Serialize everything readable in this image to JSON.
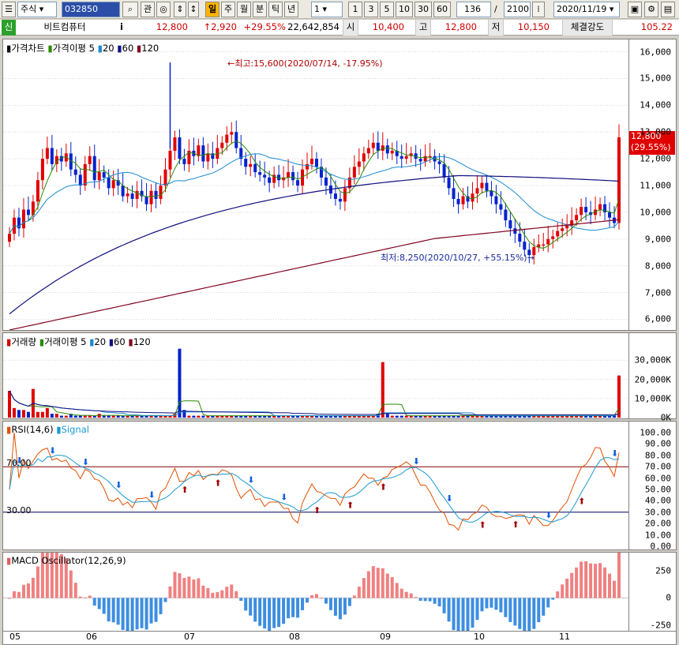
{
  "toolbar": {
    "category": "주식",
    "code": "032850",
    "search_icon": "magnifier-icon",
    "gwan_label": "관",
    "periods": [
      "일",
      "주",
      "월",
      "분",
      "틱",
      "년"
    ],
    "active_period": "일",
    "interval_value": "1",
    "interval_buttons": [
      "1",
      "3",
      "5",
      "10",
      "30",
      "60"
    ],
    "count_value": "136",
    "slash": "/",
    "total_value": "2100",
    "date_value": "2020/11/19",
    "icon_names": [
      "window-icon",
      "settings-icon",
      "save-icon"
    ]
  },
  "info_bar": {
    "badge": "신",
    "stock_name": "비트컴퓨터",
    "info_icon": "i",
    "price": "12,800",
    "change": "↑2,920",
    "change_pct": "+29.55%",
    "volume": "22,642,854",
    "open_label": "시",
    "open_value": "10,400",
    "high_label": "고",
    "high_value": "12,800",
    "low_label": "저",
    "low_value": "10,150",
    "strength_label": "체결강도",
    "strength_value": "105.22"
  },
  "price_pane": {
    "legend": {
      "title": "가격차트",
      "ma_label": "가격이평",
      "periods": [
        "5",
        "20",
        "60",
        "120"
      ]
    },
    "y_ticks": [
      "16,000",
      "15,000",
      "14,000",
      "13,000",
      "12,000",
      "11,000",
      "10,000",
      "9,000",
      "8,000",
      "7,000",
      "6,000"
    ],
    "current_tag_price": "12,800",
    "current_tag_pct": "(29.55%)",
    "high_annotation": "←최고:15,600(2020/07/14, -17.95%)",
    "low_annotation": "최저:8,250(2020/10/27, +55.15%)→"
  },
  "volume_pane": {
    "legend": {
      "title": "거래량",
      "ma_label": "거래이평",
      "periods": [
        "5",
        "20",
        "60",
        "120"
      ]
    },
    "y_ticks": [
      "30,000K",
      "20,000K",
      "10,000K",
      "0K"
    ]
  },
  "rsi_pane": {
    "legend": {
      "title": "RSI(14,6)",
      "signal": "Signal"
    },
    "y_ticks": [
      "100.00",
      "90.00",
      "80.00",
      "70.00",
      "60.00",
      "50.00",
      "40.00",
      "30.00",
      "20.00",
      "10.00",
      "0.00"
    ],
    "upper_label": "70.00",
    "lower_label": "30.00"
  },
  "macd_pane": {
    "legend": {
      "title": "MACD Oscillator(12,26,9)"
    },
    "y_ticks": [
      "250",
      "0",
      "-250"
    ]
  },
  "x_axis": [
    "05",
    "06",
    "07",
    "08",
    "09",
    "10",
    "11"
  ],
  "colors": {
    "up": "#e00000",
    "down": "#0022cc",
    "ma5": "#2a8a00",
    "ma20": "#1a8ad0",
    "ma60": "#101080",
    "ma120": "#800020"
  },
  "chart_data": {
    "type": "candlestick",
    "prices": [
      9200,
      9800,
      9400,
      10100,
      9900,
      10400,
      11200,
      12000,
      12400,
      11800,
      12100,
      11900,
      12200,
      11600,
      11400,
      11000,
      11800,
      12100,
      11200,
      11500,
      11300,
      10900,
      11200,
      11000,
      10600,
      10700,
      10500,
      10800,
      10600,
      10300,
      10800,
      10500,
      11000,
      11600,
      12300,
      12800,
      12000,
      11800,
      12300,
      12100,
      12500,
      11900,
      12200,
      12000,
      12400,
      12600,
      12900,
      13000,
      12400,
      12000,
      11700,
      11800,
      11500,
      11400,
      11300,
      11100,
      11400,
      11200,
      11300,
      11500,
      11200,
      11000,
      11600,
      11800,
      12000,
      11700,
      11300,
      11000,
      10700,
      10500,
      10400,
      10900,
      11300,
      11700,
      11900,
      12200,
      12400,
      12600,
      12300,
      12500,
      12200,
      12300,
      12100,
      12000,
      12100,
      12200,
      12000,
      11900,
      12100,
      12100,
      11900,
      11800,
      11300,
      10900,
      10500,
      10300,
      10600,
      10400,
      10700,
      10900,
      11100,
      10800,
      10600,
      10300,
      10100,
      9700,
      9400,
      9200,
      8900,
      8600,
      8400,
      8700,
      8800,
      8800,
      9000,
      9100,
      9300,
      9400,
      9500,
      9700,
      9900,
      10200,
      10000,
      9900,
      10100,
      10300,
      10000,
      9800,
      9600,
      12800
    ],
    "volumes": [
      14,
      5,
      4,
      4,
      3,
      15,
      3,
      3,
      5,
      2,
      2,
      1,
      1,
      2,
      1,
      1,
      1,
      1,
      1,
      2,
      1,
      1,
      1,
      1,
      1,
      1,
      1,
      1,
      1,
      1,
      1,
      1,
      1,
      1,
      1,
      2,
      36,
      4,
      1,
      1,
      1,
      1,
      1,
      1,
      1,
      1,
      1,
      1,
      1,
      1,
      1,
      1,
      1,
      1,
      1,
      1,
      1,
      1,
      1,
      1,
      1,
      1,
      1,
      1,
      1,
      1,
      1,
      1,
      1,
      1,
      1,
      1,
      1,
      1,
      1,
      1,
      1,
      1,
      2,
      29,
      2,
      1,
      1,
      1,
      1,
      1,
      1,
      1,
      1,
      1,
      1,
      1,
      1,
      1,
      1,
      1,
      1,
      1,
      1,
      1,
      1,
      1,
      1,
      1,
      1,
      1,
      1,
      1,
      1,
      1,
      1,
      1,
      1,
      1,
      1,
      1,
      1,
      1,
      1,
      1,
      1,
      1,
      1,
      1,
      1,
      1,
      1,
      1,
      1,
      22
    ]
  }
}
